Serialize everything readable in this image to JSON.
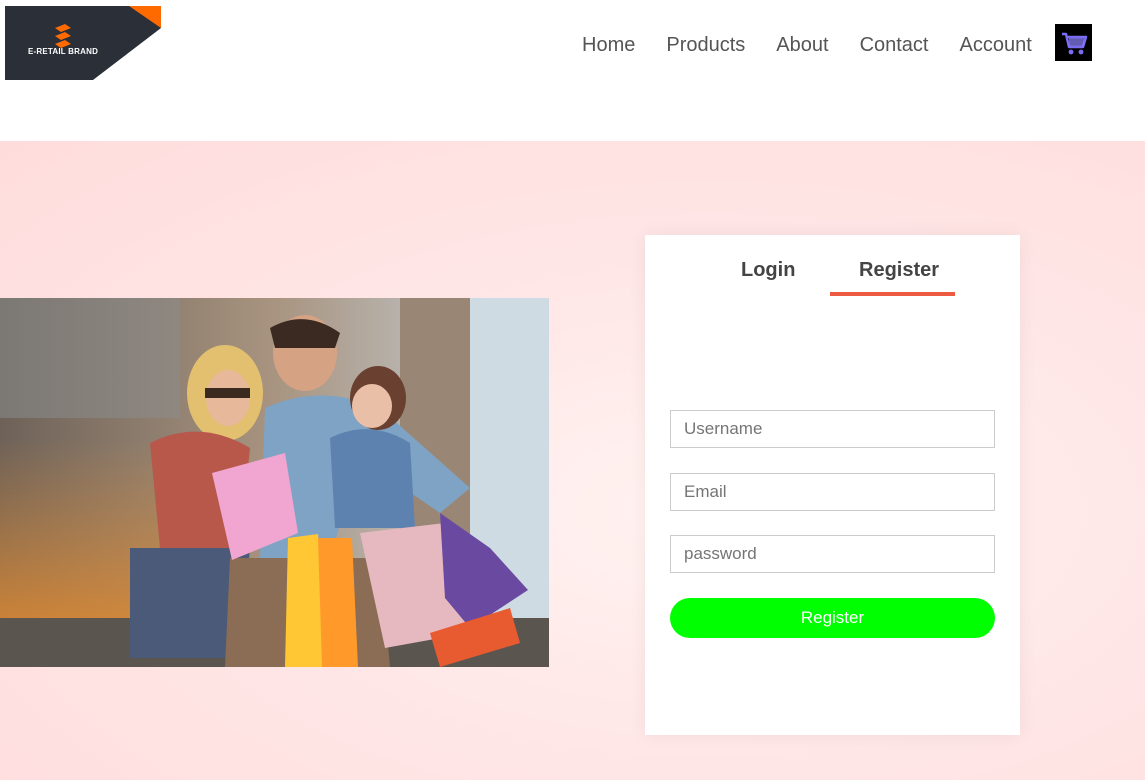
{
  "header": {
    "logo_text": "E-RETAIL BRAND",
    "nav": [
      "Home",
      "Products",
      "About",
      "Contact",
      "Account"
    ],
    "cart_icon": "shopping-cart-icon"
  },
  "hero_image": {
    "description_icon": "family-shopping-photo"
  },
  "form": {
    "tabs": [
      "Login",
      "Register"
    ],
    "active_tab": "Register",
    "username_placeholder": "Username",
    "email_placeholder": "Email",
    "password_placeholder": "password",
    "submit_label": "Register"
  },
  "colors": {
    "accent": "#ec5a42",
    "submit": "#00ff00",
    "logo_bg": "#2a2f38",
    "logo_accent": "#ff6a00",
    "background": "#ffe3e3"
  }
}
